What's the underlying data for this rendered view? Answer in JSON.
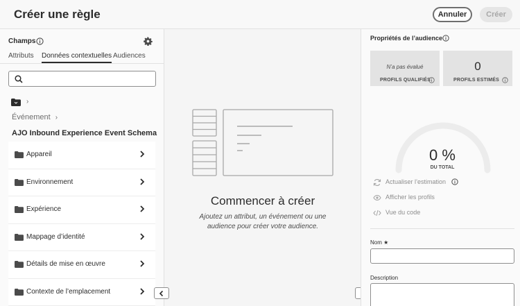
{
  "header": {
    "title": "Créer une règle",
    "cancel_label": "Annuler",
    "create_label": "Créer"
  },
  "left_panel": {
    "title": "Champs",
    "tabs": [
      {
        "label": "Attributs",
        "active": false
      },
      {
        "label": "Données contextuelles",
        "active": true
      },
      {
        "label": "Audiences",
        "active": false
      }
    ],
    "search": {
      "value": "",
      "placeholder": ""
    },
    "breadcrumb": "Événement",
    "schema_title": "AJO Inbound Experience Event Schema",
    "items": [
      {
        "label": "Appareil"
      },
      {
        "label": "Environnement"
      },
      {
        "label": "Expérience"
      },
      {
        "label": "Mappage d’identité"
      },
      {
        "label": "Détails de mise en œuvre"
      },
      {
        "label": "Contexte de l’emplacement"
      }
    ]
  },
  "center": {
    "title": "Commencer à créer",
    "description": "Ajoutez un attribut, un événement ou une audience pour créer votre audience."
  },
  "right_panel": {
    "title": "Propriétés de l’audience",
    "qualified": {
      "value": "N’a pas évalué",
      "label": "PROFILS QUALIFIÉS"
    },
    "estimated": {
      "value": "0",
      "label": "PROFILS ESTIMÉS"
    },
    "gauge": {
      "value": "0 %",
      "label": "DU TOTAL"
    },
    "actions": [
      {
        "label": "Actualiser l’estimation",
        "icon": "refresh-icon"
      },
      {
        "label": "Afficher les profils",
        "icon": "eye-icon"
      },
      {
        "label": "Vue du code",
        "icon": "code-icon"
      }
    ],
    "fields": {
      "name_label": "Nom ★",
      "name_value": "",
      "description_label": "Description",
      "description_value": ""
    }
  },
  "colors": {
    "primary_text": "#2c2c2c",
    "disabled_button": "#e6e6e6",
    "card_bg": "#e3e3e3"
  }
}
